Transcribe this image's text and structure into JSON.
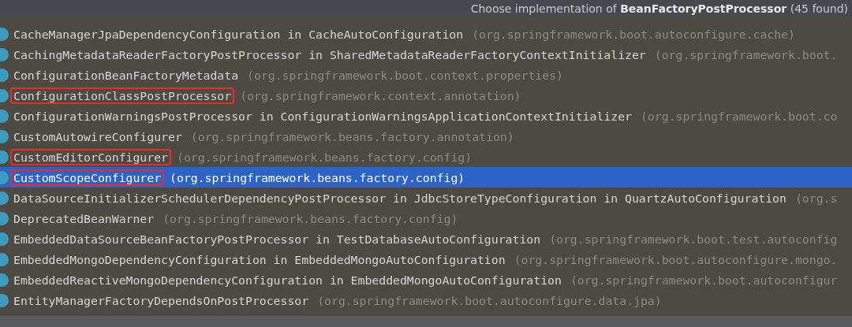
{
  "popup": {
    "title": "Choose implementation of **BeanFactoryPostProcessor** (45 found)"
  },
  "items": [
    {
      "name": "CacheManagerJpaDependencyConfiguration in CacheAutoConfiguration",
      "package": "(org.springframework.boot.autoconfigure.cache)",
      "selected": false,
      "marked": false
    },
    {
      "name": "CachingMetadataReaderFactoryPostProcessor in SharedMetadataReaderFactoryContextInitializer",
      "package": "(org.springframework.boot.",
      "selected": false,
      "marked": false
    },
    {
      "name": "ConfigurationBeanFactoryMetadata",
      "package": "(org.springframework.boot.context.properties)",
      "selected": false,
      "marked": false
    },
    {
      "name": "ConfigurationClassPostProcessor",
      "package": "(org.springframework.context.annotation)",
      "selected": false,
      "marked": true
    },
    {
      "name": "ConfigurationWarningsPostProcessor in ConfigurationWarningsApplicationContextInitializer",
      "package": "(org.springframework.boot.co",
      "selected": false,
      "marked": false
    },
    {
      "name": "CustomAutowireConfigurer",
      "package": "(org.springframework.beans.factory.annotation)",
      "selected": false,
      "marked": false
    },
    {
      "name": "CustomEditorConfigurer",
      "package": "(org.springframework.beans.factory.config)",
      "selected": false,
      "marked": true
    },
    {
      "name": "CustomScopeConfigurer",
      "package": "(org.springframework.beans.factory.config)",
      "selected": true,
      "marked": true
    },
    {
      "name": "DataSourceInitializerSchedulerDependencyPostProcessor in JdbcStoreTypeConfiguration in QuartzAutoConfiguration",
      "package": "(org.s",
      "selected": false,
      "marked": false
    },
    {
      "name": "DeprecatedBeanWarner",
      "package": "(org.springframework.beans.factory.config)",
      "selected": false,
      "marked": false
    },
    {
      "name": "EmbeddedDataSourceBeanFactoryPostProcessor in TestDatabaseAutoConfiguration",
      "package": "(org.springframework.boot.test.autoconfig",
      "selected": false,
      "marked": false
    },
    {
      "name": "EmbeddedMongoDependencyConfiguration in EmbeddedMongoAutoConfiguration",
      "package": "(org.springframework.boot.autoconfigure.mongo.",
      "selected": false,
      "marked": false
    },
    {
      "name": "EmbeddedReactiveMongoDependencyConfiguration in EmbeddedMongoAutoConfiguration",
      "package": "(org.springframework.boot.autoconfigur",
      "selected": false,
      "marked": false
    },
    {
      "name": "EntityManagerFactoryDependsOnPostProcessor",
      "package": "(org.springframework.boot.autoconfigure.data.jpa)",
      "selected": false,
      "marked": false
    }
  ]
}
